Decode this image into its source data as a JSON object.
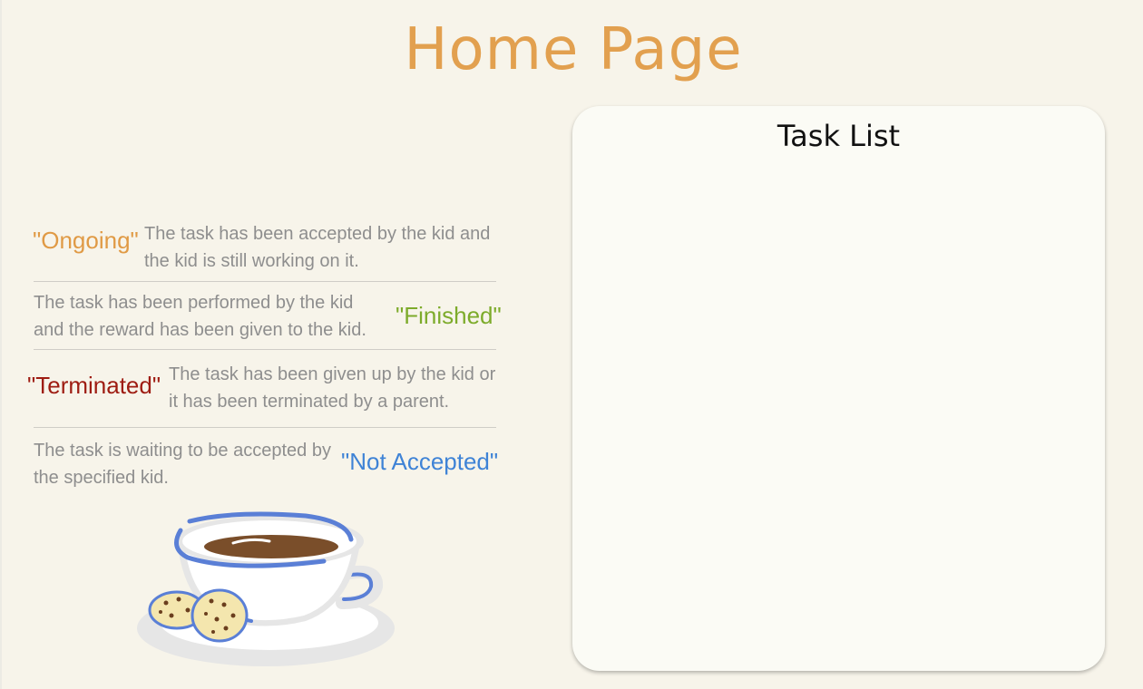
{
  "page": {
    "title": "Home Page"
  },
  "legend": [
    {
      "status": "\"Ongoing\"",
      "color": "#e09a45",
      "line1": "The task has been accepted by the kid and",
      "line2": "the kid is still working on it."
    },
    {
      "status": "\"Finished\"",
      "color": "#7dab2b",
      "line1": "The task has been performed by the kid",
      "line2": "and the reward has been  given to the kid."
    },
    {
      "status": "\"Terminated\"",
      "color": "#9e1c12",
      "line1": "The task has been given up by the kid or",
      "line2": "it has been terminated by a parent."
    },
    {
      "status": "\"Not Accepted\"",
      "color": "#3f83d6",
      "line1": "The task is waiting to be accepted by",
      "line2": "the specified kid."
    }
  ],
  "task_list": {
    "title": "Task List",
    "items": []
  },
  "illustration": {
    "name": "coffee-cup-with-cookies"
  }
}
